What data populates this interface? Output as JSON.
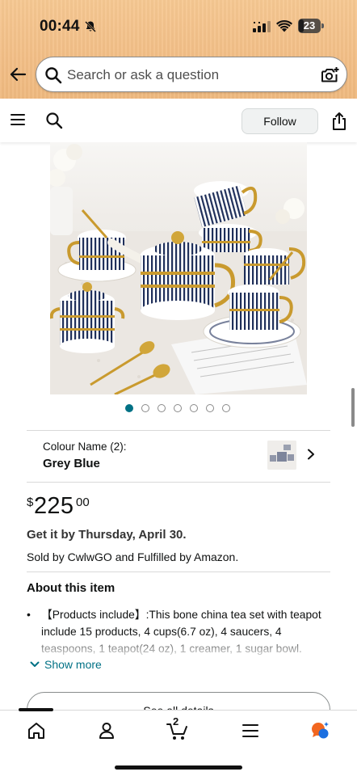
{
  "status_bar": {
    "time": "00:44",
    "battery_level": "23",
    "icons": [
      "bell-off-icon",
      "cellular-signal-icon",
      "wifi-icon",
      "battery-icon"
    ]
  },
  "search": {
    "placeholder": "Search or ask a question",
    "icons": [
      "back-arrow-icon",
      "search-icon",
      "camera-search-icon"
    ]
  },
  "toolbar": {
    "follow_label": "Follow",
    "icons": [
      "hamburger-menu-icon",
      "search-icon",
      "share-icon"
    ]
  },
  "gallery": {
    "image_count": 7,
    "active_index": 0
  },
  "variation": {
    "label": "Colour Name (2):",
    "value": "Grey Blue"
  },
  "price": {
    "symbol": "$",
    "whole": "225",
    "fraction": "00"
  },
  "delivery": "Get it by Thursday, April 30.",
  "sold_by": "Sold by CwlwGO and Fulfilled by Amazon.",
  "about": {
    "title": "About this item",
    "bullets": [
      "【Products include】:This bone china tea set with teapot include 15 products, 4 cups(6.7 oz), 4 saucers, 4 teaspoons, 1 teapot(24 oz), 1 creamer, 1 sugar bowl."
    ],
    "show_more": "Show more"
  },
  "see_all_details": "See all details",
  "bottom_nav": {
    "cart_count": "2",
    "items": [
      "home-icon",
      "account-icon",
      "cart-icon",
      "menu-icon",
      "rufus-ai-icon"
    ]
  },
  "colors": {
    "accent_link": "#007185",
    "header_bg": "#f2be86",
    "text": "#0f1111"
  }
}
